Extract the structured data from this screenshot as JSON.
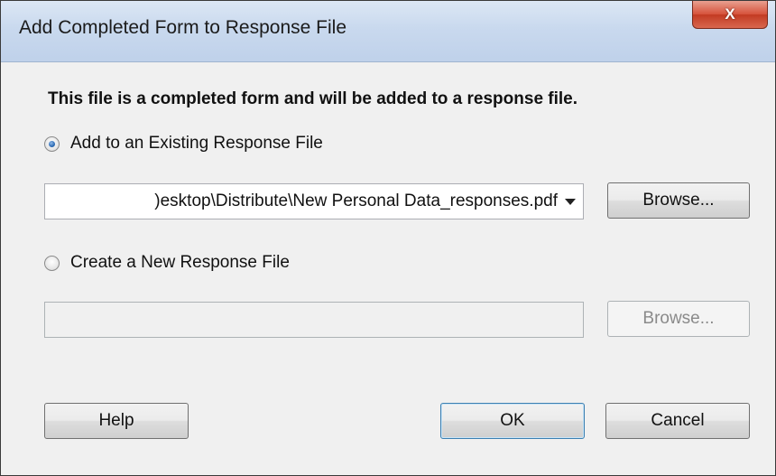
{
  "dialog": {
    "title": "Add Completed Form to Response File",
    "close_label": "X",
    "heading": "This file is a completed form and will be added to a response file."
  },
  "existing_option": {
    "label": "Add to an Existing Response File",
    "selected": true,
    "path_value": ")esktop\\Distribute\\New Personal Data_responses.pdf",
    "browse_label": "Browse..."
  },
  "new_option": {
    "label": "Create a New Response File",
    "selected": false,
    "path_value": "",
    "browse_label": "Browse..."
  },
  "footer": {
    "help_label": "Help",
    "ok_label": "OK",
    "cancel_label": "Cancel"
  }
}
